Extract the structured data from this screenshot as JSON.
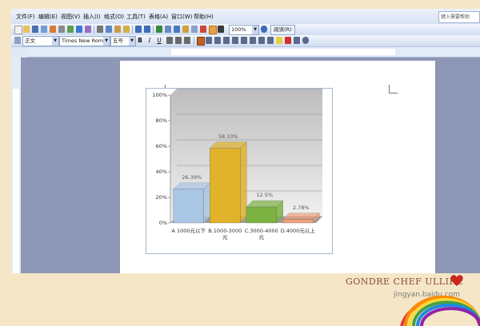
{
  "menubar": {
    "items": [
      "文件(F)",
      "编辑(E)",
      "视图(V)",
      "插入(I)",
      "格式(O)",
      "工具(T)",
      "表格(A)",
      "窗口(W)",
      "帮助(H)"
    ],
    "help_placeholder": "键入需要帮助"
  },
  "toolbar": {
    "zoom": "100%",
    "read_label": "阅读(R)"
  },
  "format_bar": {
    "style": "正文",
    "font": "Times New Roma",
    "size": "五号",
    "bold": "B",
    "italic": "I",
    "underline": "U"
  },
  "chart_data": {
    "type": "bar",
    "categories": [
      "A 1000元以下",
      "B.1000-3000元",
      "C.3000-4000元",
      "D.4000元以上"
    ],
    "values": [
      26.39,
      58.33,
      12.5,
      2.78
    ],
    "value_labels": [
      "26.39%",
      "58.33%",
      "12.5%",
      "2.78%"
    ],
    "yticks": [
      "0%",
      "20%",
      "40%",
      "60%",
      "80%",
      "100%"
    ],
    "ylim": [
      0,
      100
    ],
    "colors": [
      "#a9c6e4",
      "#e0b32a",
      "#7cb241",
      "#f0a27c"
    ],
    "grid": true
  },
  "decoration": {
    "signature": "GONDRE CHEF ULLIRE",
    "watermark": "jingyan.baidu.com"
  }
}
